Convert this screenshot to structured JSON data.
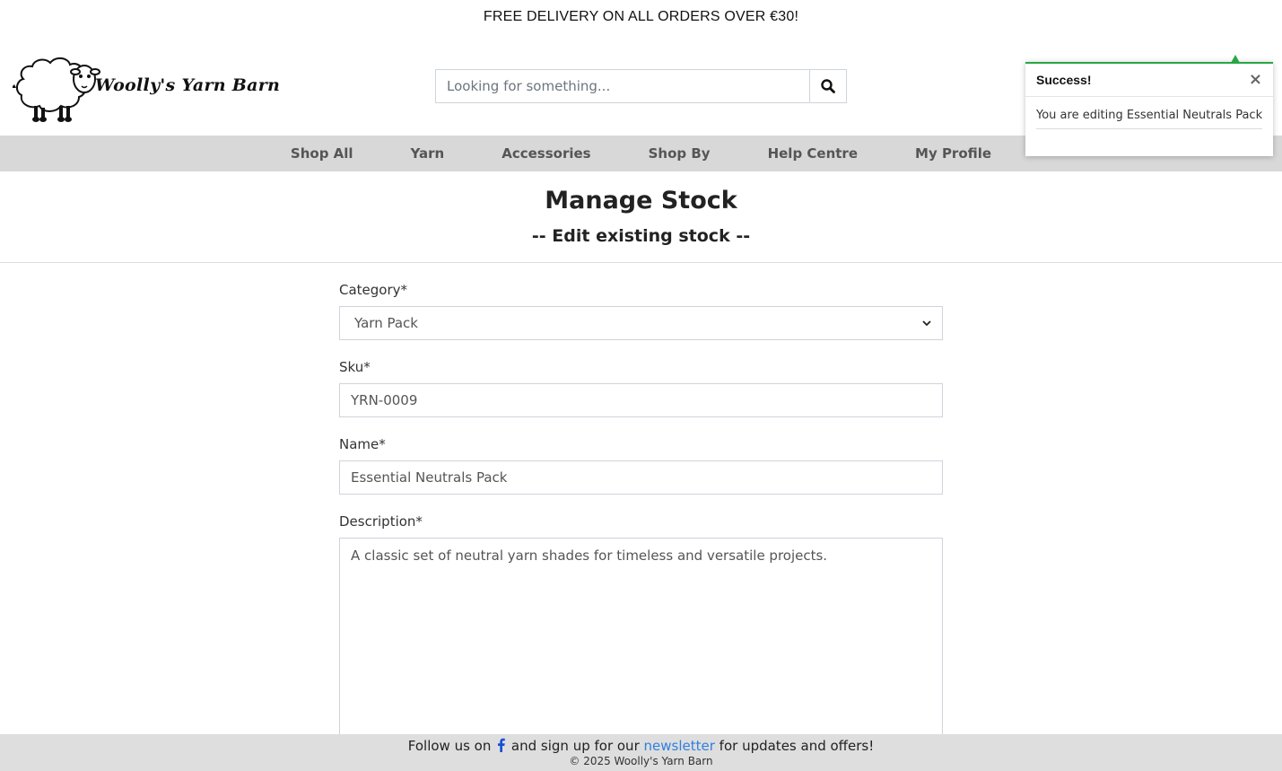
{
  "promo": {
    "text": "FREE DELIVERY ON ALL ORDERS OVER €30!"
  },
  "header": {
    "brand": "Woolly's Yarn Barn",
    "search": {
      "placeholder": "Looking for something...",
      "value": ""
    }
  },
  "nav": {
    "items": [
      {
        "label": "Shop All"
      },
      {
        "label": "Yarn"
      },
      {
        "label": "Accessories"
      },
      {
        "label": "Shop By"
      },
      {
        "label": "Help Centre"
      },
      {
        "label": "My Profile"
      }
    ]
  },
  "toast": {
    "title": "Success!",
    "close_label": "×",
    "message": "You are editing Essential Neutrals Pack",
    "accent_color": "#28a745"
  },
  "page": {
    "title": "Manage Stock",
    "subtitle": "-- Edit existing stock --"
  },
  "form": {
    "category": {
      "label": "Category*",
      "value": "Yarn Pack"
    },
    "sku": {
      "label": "Sku*",
      "value": "YRN-0009"
    },
    "name": {
      "label": "Name*",
      "value": "Essential Neutrals Pack"
    },
    "description": {
      "label": "Description*",
      "value": "A classic set of neutral yarn shades for timeless and versatile projects."
    }
  },
  "footer": {
    "follow_prefix": "Follow us on",
    "follow_middle": "and sign up for our",
    "newsletter_link": "newsletter",
    "follow_suffix": "for updates and offers!",
    "copyright": "© 2025 Woolly's Yarn Barn",
    "icon": "facebook-icon",
    "link_color": "#2f7fe0"
  }
}
